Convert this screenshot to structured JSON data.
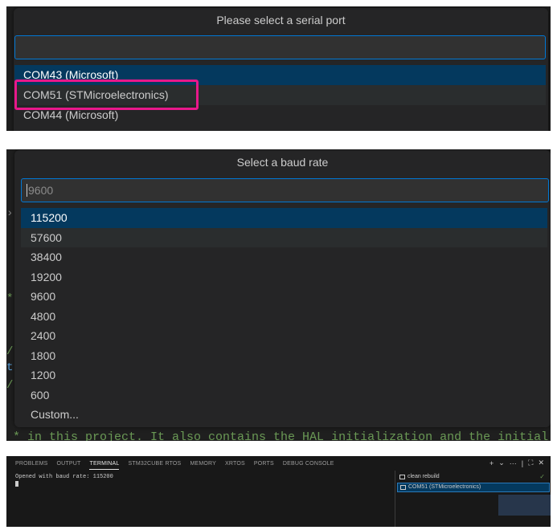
{
  "serial_port_picker": {
    "title": "Please select a serial port",
    "input_value": "",
    "items": [
      {
        "label": "COM43 (Microsoft)"
      },
      {
        "label": "COM51 (STMicroelectronics)"
      },
      {
        "label": "COM44 (Microsoft)"
      }
    ],
    "highlight_color": "#e8188b"
  },
  "baud_rate_picker": {
    "title": "Select a baud rate",
    "placeholder": "9600",
    "items": [
      {
        "label": "115200"
      },
      {
        "label": "57600"
      },
      {
        "label": "38400"
      },
      {
        "label": "19200"
      },
      {
        "label": "9600"
      },
      {
        "label": "4800"
      },
      {
        "label": "2400"
      },
      {
        "label": "1800"
      },
      {
        "label": "1200"
      },
      {
        "label": "600"
      },
      {
        "label": "Custom..."
      }
    ],
    "background_code_line": "* in this project. It also contains the HAL initialization and the initial"
  },
  "terminal_panel": {
    "tabs": [
      {
        "label": "PROBLEMS"
      },
      {
        "label": "OUTPUT"
      },
      {
        "label": "TERMINAL"
      },
      {
        "label": "STM32CUBE RTOS"
      },
      {
        "label": "MEMORY"
      },
      {
        "label": "XRTOS"
      },
      {
        "label": "PORTS"
      },
      {
        "label": "DEBUG CONSOLE"
      }
    ],
    "active_tab": "TERMINAL",
    "output_line": "Opened with baud rate: 115200",
    "terminals": [
      {
        "label": "clean rebuild",
        "icon": "terminal-icon"
      },
      {
        "label": "COM51 (STMicroelectronics)",
        "icon": "terminal-icon"
      }
    ]
  },
  "colors": {
    "selected_row": "#04395e",
    "focus_border": "#0078d4",
    "quick_pick_bg": "#252526"
  }
}
